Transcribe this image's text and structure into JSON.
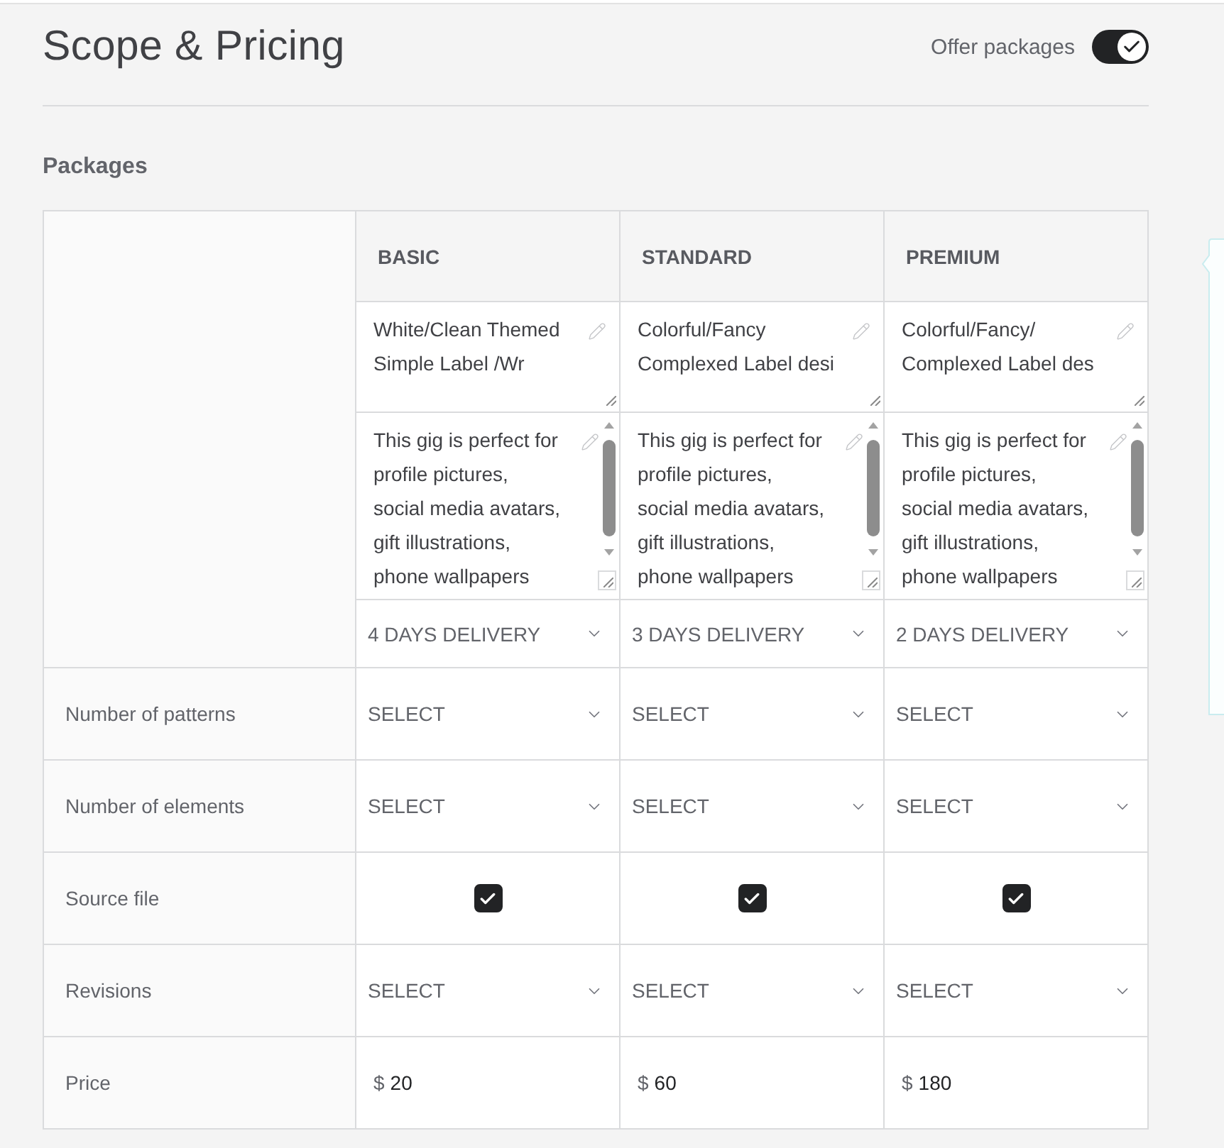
{
  "page_title": "Scope & Pricing",
  "offer_packages": {
    "label": "Offer packages",
    "on": true
  },
  "section_title": "Packages",
  "packages": [
    {
      "name": "BASIC",
      "title": "White/Clean Themed\nSimple Label /Wr",
      "description": "This gig is perfect for\nprofile pictures,\nsocial media avatars,\ngift illustrations,\nphone wallpapers",
      "delivery": "4 DAYS DELIVERY"
    },
    {
      "name": "STANDARD",
      "title": "Colorful/Fancy\nComplexed Label desi",
      "description": "This gig is perfect for\nprofile pictures,\nsocial media avatars,\ngift illustrations,\nphone wallpapers",
      "delivery": "3 DAYS DELIVERY"
    },
    {
      "name": "PREMIUM",
      "title": "Colorful/Fancy/\nComplexed Label des",
      "description": "This gig is perfect for\nprofile pictures,\nsocial media avatars,\ngift illustrations,\nphone wallpapers",
      "delivery": "2 DAYS DELIVERY"
    }
  ],
  "features": [
    {
      "label": "Number of patterns",
      "kind": "select",
      "cells": [
        {
          "value": "SELECT"
        },
        {
          "value": "SELECT"
        },
        {
          "value": "SELECT"
        }
      ]
    },
    {
      "label": "Number of elements",
      "kind": "select",
      "cells": [
        {
          "value": "SELECT"
        },
        {
          "value": "SELECT"
        },
        {
          "value": "SELECT"
        }
      ]
    },
    {
      "label": "Source file",
      "kind": "checkbox",
      "cells": [
        {
          "checked": true
        },
        {
          "checked": true
        },
        {
          "checked": true
        }
      ]
    },
    {
      "label": "Revisions",
      "kind": "select",
      "cells": [
        {
          "value": "SELECT"
        },
        {
          "value": "SELECT"
        },
        {
          "value": "SELECT"
        }
      ]
    },
    {
      "label": "Price",
      "kind": "price",
      "cells": [
        {
          "currency": "$",
          "value": "20"
        },
        {
          "currency": "$",
          "value": "60"
        },
        {
          "currency": "$",
          "value": "180"
        }
      ]
    }
  ]
}
